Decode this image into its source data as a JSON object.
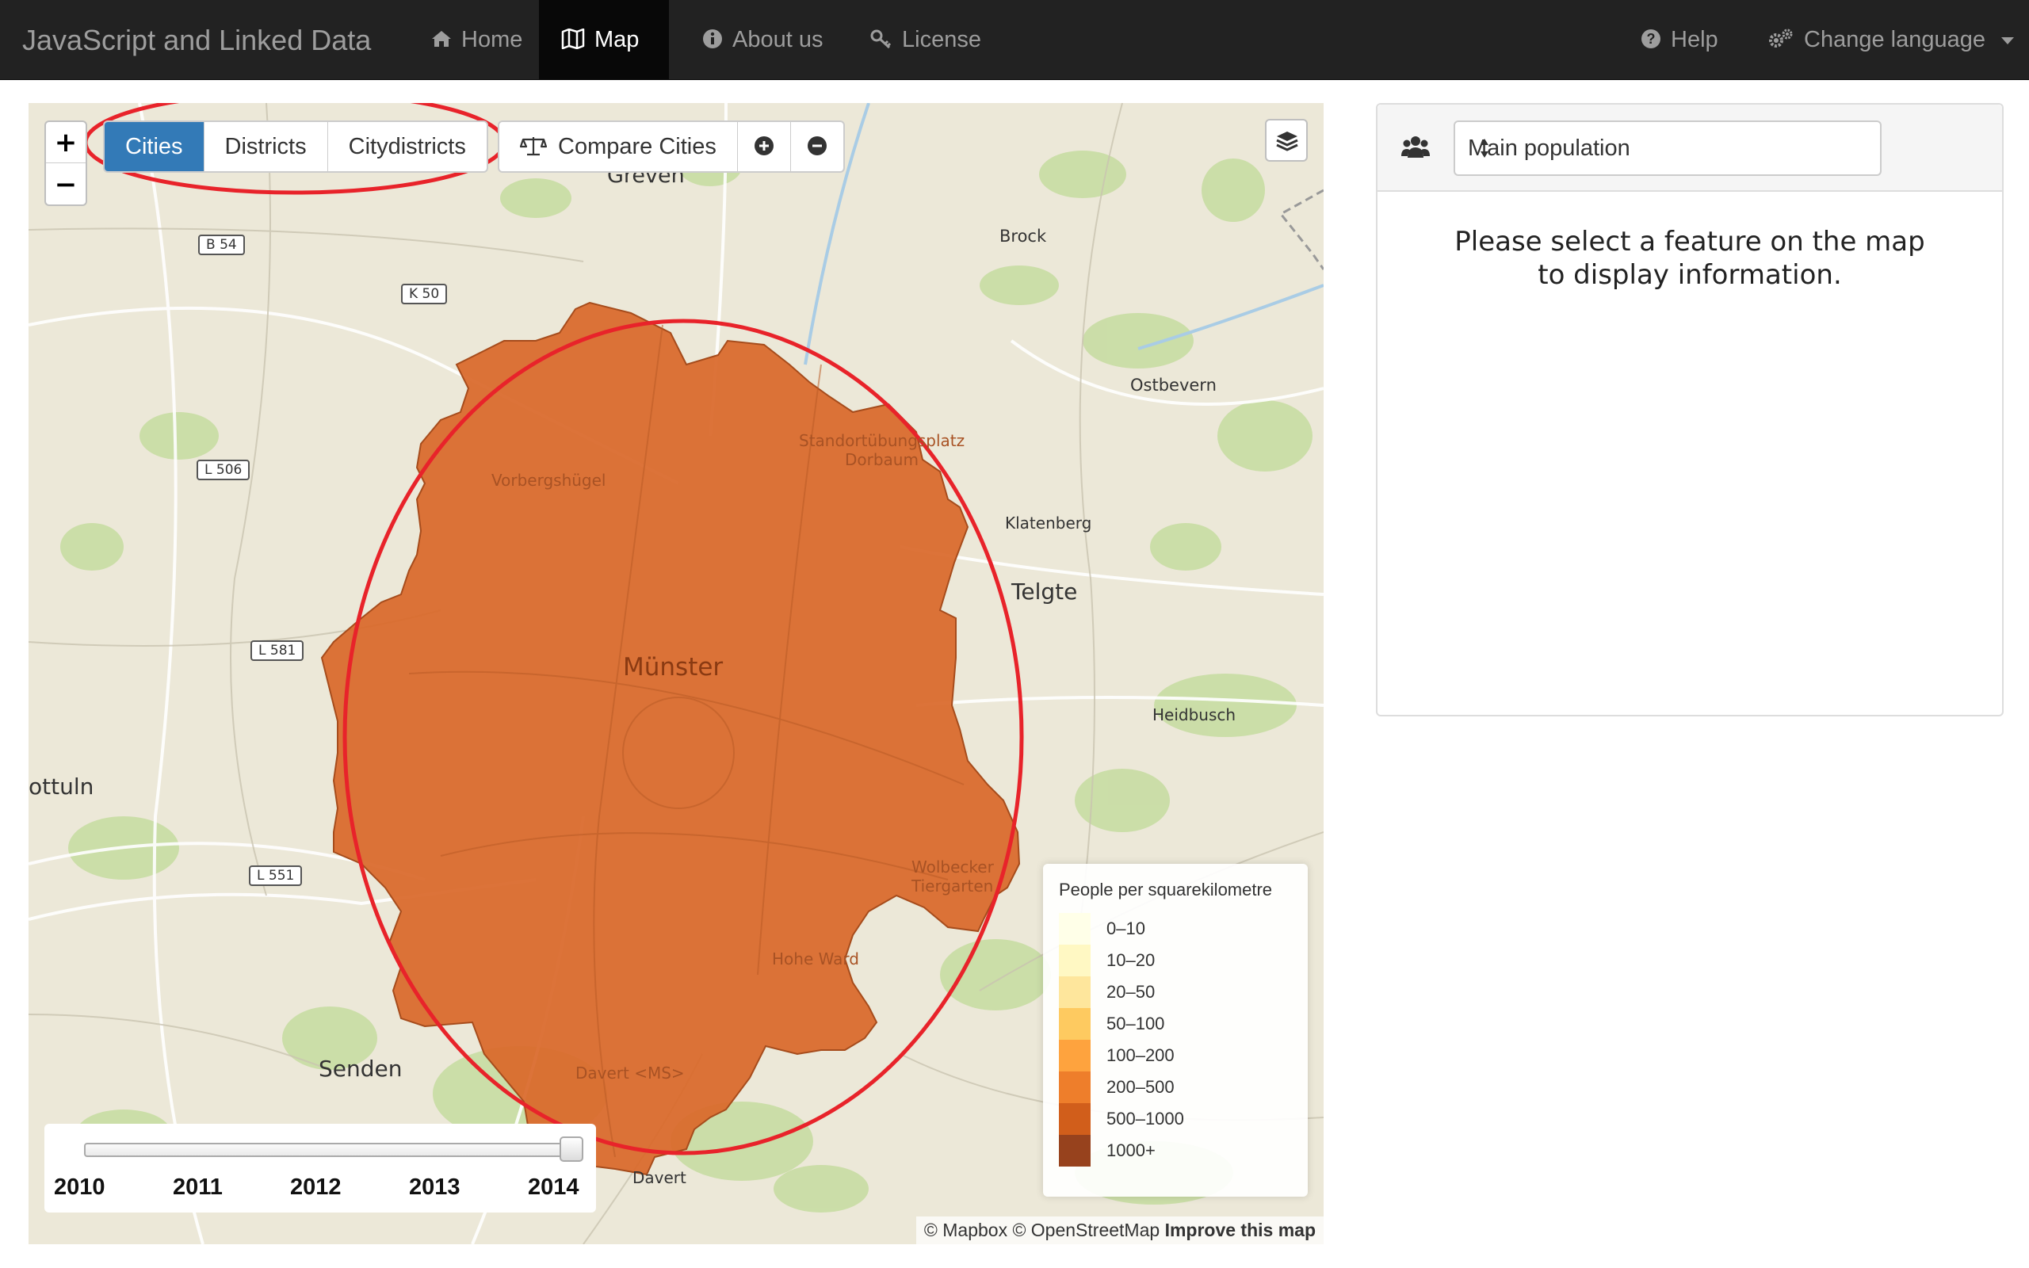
{
  "navbar": {
    "brand": "JavaScript and Linked Data",
    "items": [
      {
        "label": "Home",
        "icon": "home-icon"
      },
      {
        "label": "Map",
        "icon": "map-icon",
        "active": true
      },
      {
        "label": "About us",
        "icon": "info-icon"
      },
      {
        "label": "License",
        "icon": "key-icon"
      }
    ],
    "help": {
      "label": "Help",
      "icon": "question-icon"
    },
    "language": {
      "label": "Change language",
      "icon": "gears-icon"
    }
  },
  "map": {
    "zoom_in": "+",
    "zoom_out": "−",
    "level_buttons": [
      "Cities",
      "Districts",
      "Citydistricts"
    ],
    "active_level": "Cities",
    "compare_label": "Compare Cities",
    "city_fill_color": "#d9682a",
    "labels": {
      "greven": "Greven",
      "brock": "Brock",
      "ostbevern": "Ostbevern",
      "standort": "Standortübungsplatz",
      "dorbaum": "Dorbaum",
      "vorbergshuegel": "Vorbergshügel",
      "klatenberg": "Klatenberg",
      "telgte": "Telgte",
      "muenster": "Münster",
      "heidbusch": "Heidbusch",
      "nottuln": "ottuln",
      "wolbecker": "Wolbecker",
      "tiergarten": "Tiergarten",
      "hohe_ward": "Hohe Ward",
      "senden": "Senden",
      "davert_ms": "Davert <MS>",
      "davert": "Davert"
    },
    "roads": {
      "b54": "B 54",
      "k50": "K 50",
      "l506": "L 506",
      "l581": "L 581",
      "l551": "L 551"
    },
    "legend": {
      "title": "People per squarekilometre",
      "items": [
        {
          "label": "0–10",
          "color": "#ffffe5"
        },
        {
          "label": "10–20",
          "color": "#fff7bc"
        },
        {
          "label": "20–50",
          "color": "#fee391"
        },
        {
          "label": "50–100",
          "color": "#fec44f"
        },
        {
          "label": "100–200",
          "color": "#fe9929"
        },
        {
          "label": "200–500",
          "color": "#ec7014"
        },
        {
          "label": "500–1000",
          "color": "#cc4c02"
        },
        {
          "label": "1000+",
          "color": "#8c2d04"
        }
      ]
    },
    "year_slider": {
      "years": [
        "2010",
        "2011",
        "2012",
        "2013",
        "2014"
      ],
      "selected": "2014"
    },
    "attribution": {
      "text": "© Mapbox © OpenStreetMap",
      "link": "Improve this map"
    }
  },
  "panel": {
    "select_value": "Main population",
    "message_line1": "Please select a feature on the map",
    "message_line2": "to display information."
  },
  "annotation_color": "#e8232a"
}
